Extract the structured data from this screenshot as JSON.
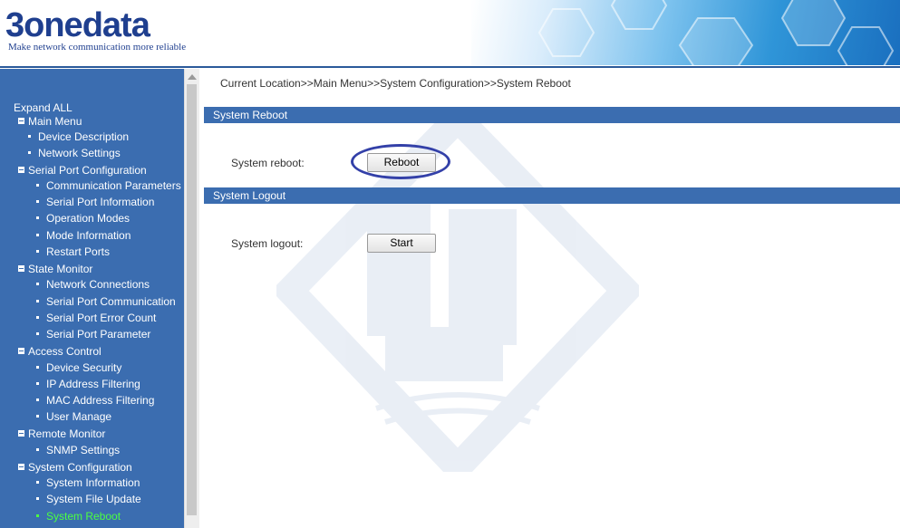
{
  "header": {
    "logo_text": "3onedata",
    "tagline": "Make network communication more reliable"
  },
  "sidebar": {
    "expand_all": "Expand ALL",
    "items": [
      {
        "label": "Main Menu",
        "level": "group"
      },
      {
        "label": "Device Description",
        "level": "item"
      },
      {
        "label": "Network Settings",
        "level": "item"
      },
      {
        "label": "Serial Port Configuration",
        "level": "group"
      },
      {
        "label": "Communication Parameters",
        "level": "sub"
      },
      {
        "label": "Serial Port Information",
        "level": "sub"
      },
      {
        "label": "Operation Modes",
        "level": "sub"
      },
      {
        "label": "Mode Information",
        "level": "sub"
      },
      {
        "label": "Restart Ports",
        "level": "sub"
      },
      {
        "label": "State Monitor",
        "level": "group"
      },
      {
        "label": "Network Connections",
        "level": "sub"
      },
      {
        "label": "Serial Port Communication",
        "level": "sub"
      },
      {
        "label": "Serial Port Error Count",
        "level": "sub"
      },
      {
        "label": "Serial Port Parameter",
        "level": "sub"
      },
      {
        "label": "Access Control",
        "level": "group"
      },
      {
        "label": "Device Security",
        "level": "sub"
      },
      {
        "label": "IP Address Filtering",
        "level": "sub"
      },
      {
        "label": "MAC Address Filtering",
        "level": "sub"
      },
      {
        "label": "User Manage",
        "level": "sub"
      },
      {
        "label": "Remote Monitor",
        "level": "group"
      },
      {
        "label": "SNMP Settings",
        "level": "sub"
      },
      {
        "label": "System Configuration",
        "level": "group"
      },
      {
        "label": "System Information",
        "level": "sub"
      },
      {
        "label": "System File Update",
        "level": "sub"
      },
      {
        "label": "System Reboot",
        "level": "sub",
        "active": true
      }
    ]
  },
  "main": {
    "breadcrumb": "Current Location>>Main Menu>>System Configuration>>System Reboot",
    "reboot_section": {
      "title": "System Reboot",
      "label": "System reboot:",
      "button": "Reboot"
    },
    "logout_section": {
      "title": "System Logout",
      "label": "System logout:",
      "button": "Start"
    }
  },
  "colors": {
    "nav_bg": "#3b6db0",
    "active_item": "#4cff40",
    "highlight_ring": "#3340a8",
    "brand": "#1f3f8f"
  }
}
